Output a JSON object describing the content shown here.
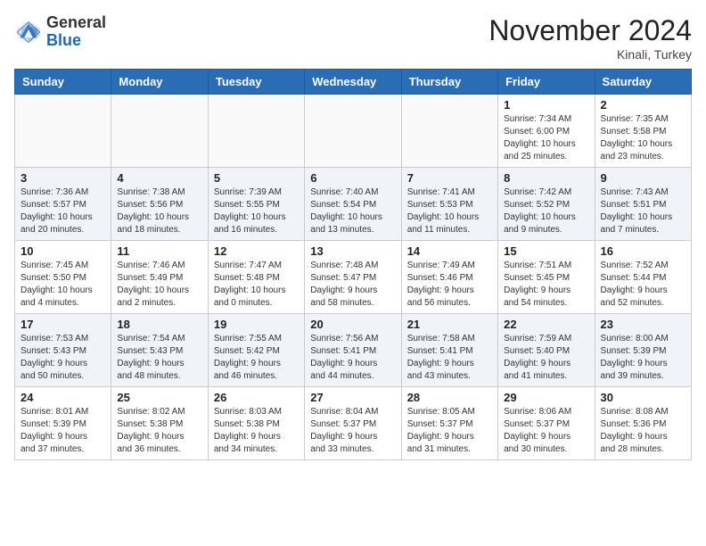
{
  "header": {
    "logo_general": "General",
    "logo_blue": "Blue",
    "month_title": "November 2024",
    "location": "Kinali, Turkey"
  },
  "weekdays": [
    "Sunday",
    "Monday",
    "Tuesday",
    "Wednesday",
    "Thursday",
    "Friday",
    "Saturday"
  ],
  "weeks": [
    [
      {
        "day": "",
        "info": ""
      },
      {
        "day": "",
        "info": ""
      },
      {
        "day": "",
        "info": ""
      },
      {
        "day": "",
        "info": ""
      },
      {
        "day": "",
        "info": ""
      },
      {
        "day": "1",
        "info": "Sunrise: 7:34 AM\nSunset: 6:00 PM\nDaylight: 10 hours\nand 25 minutes."
      },
      {
        "day": "2",
        "info": "Sunrise: 7:35 AM\nSunset: 5:58 PM\nDaylight: 10 hours\nand 23 minutes."
      }
    ],
    [
      {
        "day": "3",
        "info": "Sunrise: 7:36 AM\nSunset: 5:57 PM\nDaylight: 10 hours\nand 20 minutes."
      },
      {
        "day": "4",
        "info": "Sunrise: 7:38 AM\nSunset: 5:56 PM\nDaylight: 10 hours\nand 18 minutes."
      },
      {
        "day": "5",
        "info": "Sunrise: 7:39 AM\nSunset: 5:55 PM\nDaylight: 10 hours\nand 16 minutes."
      },
      {
        "day": "6",
        "info": "Sunrise: 7:40 AM\nSunset: 5:54 PM\nDaylight: 10 hours\nand 13 minutes."
      },
      {
        "day": "7",
        "info": "Sunrise: 7:41 AM\nSunset: 5:53 PM\nDaylight: 10 hours\nand 11 minutes."
      },
      {
        "day": "8",
        "info": "Sunrise: 7:42 AM\nSunset: 5:52 PM\nDaylight: 10 hours\nand 9 minutes."
      },
      {
        "day": "9",
        "info": "Sunrise: 7:43 AM\nSunset: 5:51 PM\nDaylight: 10 hours\nand 7 minutes."
      }
    ],
    [
      {
        "day": "10",
        "info": "Sunrise: 7:45 AM\nSunset: 5:50 PM\nDaylight: 10 hours\nand 4 minutes."
      },
      {
        "day": "11",
        "info": "Sunrise: 7:46 AM\nSunset: 5:49 PM\nDaylight: 10 hours\nand 2 minutes."
      },
      {
        "day": "12",
        "info": "Sunrise: 7:47 AM\nSunset: 5:48 PM\nDaylight: 10 hours\nand 0 minutes."
      },
      {
        "day": "13",
        "info": "Sunrise: 7:48 AM\nSunset: 5:47 PM\nDaylight: 9 hours\nand 58 minutes."
      },
      {
        "day": "14",
        "info": "Sunrise: 7:49 AM\nSunset: 5:46 PM\nDaylight: 9 hours\nand 56 minutes."
      },
      {
        "day": "15",
        "info": "Sunrise: 7:51 AM\nSunset: 5:45 PM\nDaylight: 9 hours\nand 54 minutes."
      },
      {
        "day": "16",
        "info": "Sunrise: 7:52 AM\nSunset: 5:44 PM\nDaylight: 9 hours\nand 52 minutes."
      }
    ],
    [
      {
        "day": "17",
        "info": "Sunrise: 7:53 AM\nSunset: 5:43 PM\nDaylight: 9 hours\nand 50 minutes."
      },
      {
        "day": "18",
        "info": "Sunrise: 7:54 AM\nSunset: 5:43 PM\nDaylight: 9 hours\nand 48 minutes."
      },
      {
        "day": "19",
        "info": "Sunrise: 7:55 AM\nSunset: 5:42 PM\nDaylight: 9 hours\nand 46 minutes."
      },
      {
        "day": "20",
        "info": "Sunrise: 7:56 AM\nSunset: 5:41 PM\nDaylight: 9 hours\nand 44 minutes."
      },
      {
        "day": "21",
        "info": "Sunrise: 7:58 AM\nSunset: 5:41 PM\nDaylight: 9 hours\nand 43 minutes."
      },
      {
        "day": "22",
        "info": "Sunrise: 7:59 AM\nSunset: 5:40 PM\nDaylight: 9 hours\nand 41 minutes."
      },
      {
        "day": "23",
        "info": "Sunrise: 8:00 AM\nSunset: 5:39 PM\nDaylight: 9 hours\nand 39 minutes."
      }
    ],
    [
      {
        "day": "24",
        "info": "Sunrise: 8:01 AM\nSunset: 5:39 PM\nDaylight: 9 hours\nand 37 minutes."
      },
      {
        "day": "25",
        "info": "Sunrise: 8:02 AM\nSunset: 5:38 PM\nDaylight: 9 hours\nand 36 minutes."
      },
      {
        "day": "26",
        "info": "Sunrise: 8:03 AM\nSunset: 5:38 PM\nDaylight: 9 hours\nand 34 minutes."
      },
      {
        "day": "27",
        "info": "Sunrise: 8:04 AM\nSunset: 5:37 PM\nDaylight: 9 hours\nand 33 minutes."
      },
      {
        "day": "28",
        "info": "Sunrise: 8:05 AM\nSunset: 5:37 PM\nDaylight: 9 hours\nand 31 minutes."
      },
      {
        "day": "29",
        "info": "Sunrise: 8:06 AM\nSunset: 5:37 PM\nDaylight: 9 hours\nand 30 minutes."
      },
      {
        "day": "30",
        "info": "Sunrise: 8:08 AM\nSunset: 5:36 PM\nDaylight: 9 hours\nand 28 minutes."
      }
    ]
  ]
}
